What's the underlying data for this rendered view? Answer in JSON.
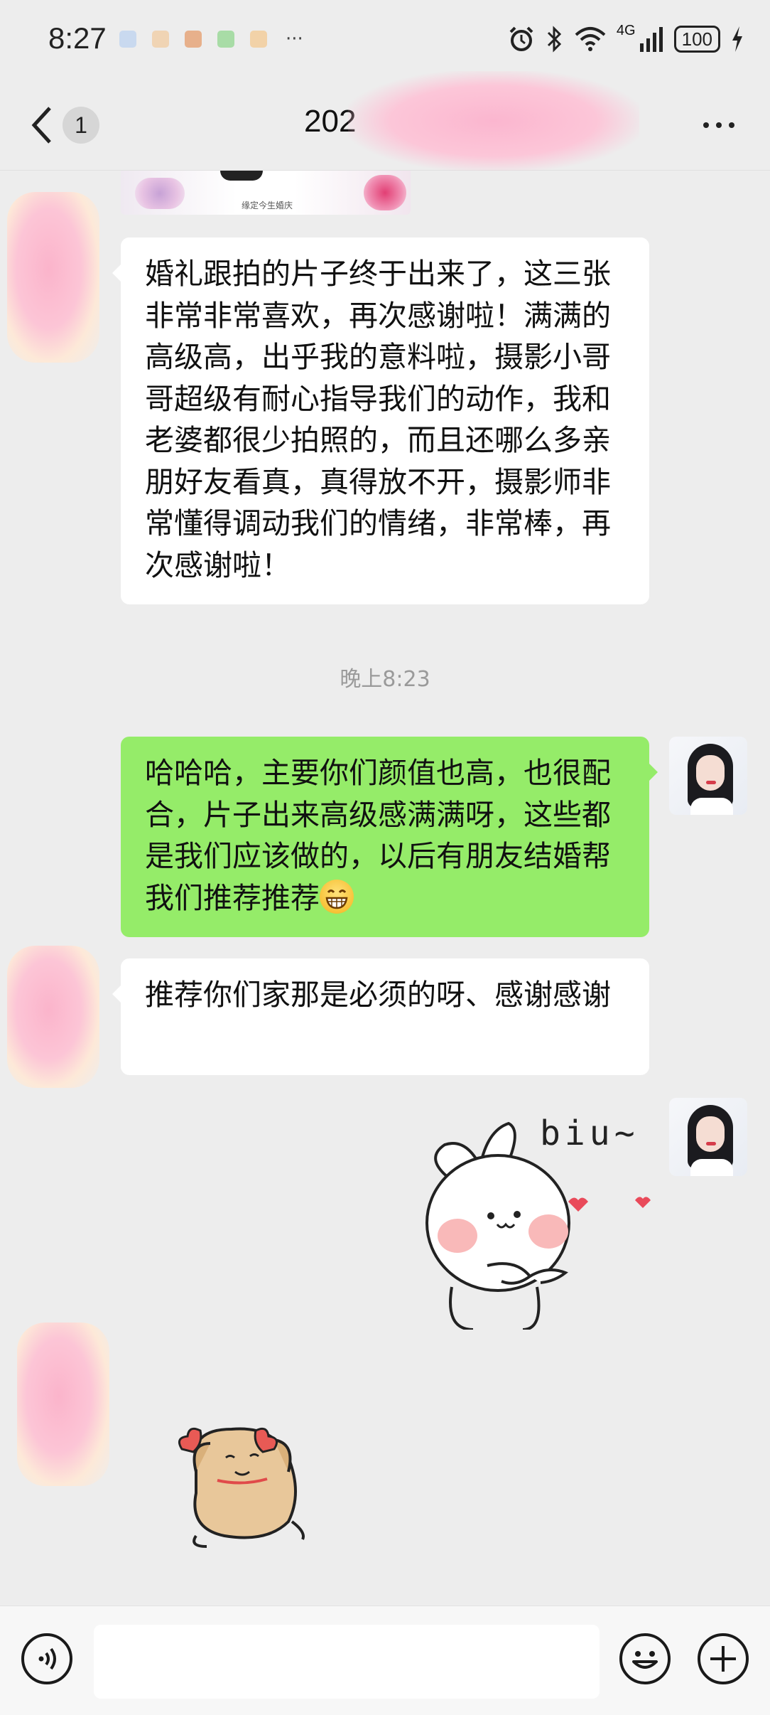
{
  "status_bar": {
    "time": "8:27",
    "notification_icons": [
      "app-notification-1",
      "app-notification-2",
      "app-notification-3",
      "app-notification-4",
      "app-notification-5"
    ],
    "overflow": "···",
    "icons": [
      "alarm-icon",
      "bluetooth-icon",
      "wifi-icon",
      "signal-icon"
    ],
    "network": "4G",
    "battery": "100"
  },
  "header": {
    "back_icon": "chevron-left-icon",
    "unread_count": "1",
    "title": "202",
    "more_icon": "more-icon"
  },
  "messages": [
    {
      "sender": "contact",
      "type": "image",
      "caption": "缘定今生婚庆"
    },
    {
      "sender": "contact",
      "type": "text",
      "text": "婚礼跟拍的片子终于出来了，这三张非常非常喜欢，再次感谢啦！满满的高级高，出乎我的意料啦，摄影小哥哥超级有耐心指导我们的动作，我和老婆都很少拍照的，而且还哪么多亲朋好友看真，真得放不开，摄影师非常懂得调动我们的情绪，非常棒，再次感谢啦！"
    },
    {
      "type": "timestamp",
      "text": "晚上8:23"
    },
    {
      "sender": "me",
      "type": "text",
      "text": "哈哈哈，主要你们颜值也高，也很配合，片子出来高级感满满呀，这些都是我们应该做的，以后有朋友结婚帮我们推荐推荐",
      "trailing_emoji": "grin-emoji"
    },
    {
      "sender": "contact",
      "type": "text",
      "text": "推荐你们家那是必须的呀、感谢感谢"
    },
    {
      "sender": "me",
      "type": "sticker",
      "sticker": "bunny-sticker",
      "caption": "biu~"
    },
    {
      "sender": "contact",
      "type": "sticker",
      "sticker": "dog-sticker"
    }
  ],
  "input_bar": {
    "voice_icon": "voice-icon",
    "text_value": "",
    "emoji_icon": "emoji-icon",
    "plus_icon": "plus-icon"
  },
  "colors": {
    "background": "#ededed",
    "bubble_incoming": "#ffffff",
    "bubble_outgoing": "#95ec69",
    "timestamp": "#9a9a9a"
  }
}
